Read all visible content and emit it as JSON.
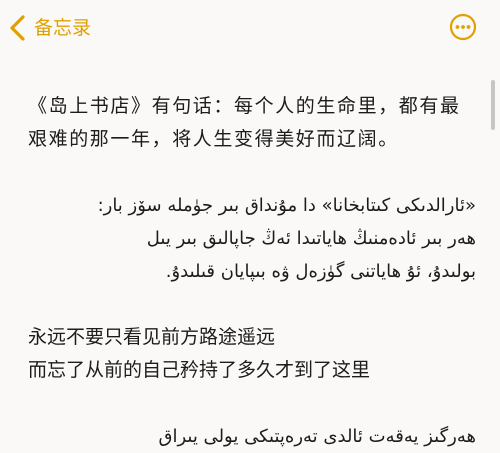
{
  "nav": {
    "back_label": "备忘录",
    "faded_title": "",
    "icons": {
      "back": "chevron-left-icon",
      "more": "more-options-icon"
    },
    "accent_color": "#e0a000"
  },
  "note": {
    "para1": "《岛上书店》有句话：每个人的生命里，都有最艰难的那一年，将人生变得美好而辽阔。",
    "ug_line1": "«ئارالدىكى كىتابخانا» دا مۇنداق بىر جۈملە سۆز بار:",
    "ug_line2": "ھەر بىر ئادەمنىڭ ھاياتىدا ئەڭ جاپالىق بىر يىل",
    "ug_line3": "بولىدۇ، ئۇ ھاياتنى گۈزەل ۋە بىپايان قىلىدۇ.",
    "cn_line1": "永远不要只看见前方路途遥远",
    "cn_line2": "而忘了从前的自己矜持了多久才到了这里",
    "ug_partial": "ھەرگىز يەقەت ئالدى تەرەپتىكى يولى يىراق"
  }
}
